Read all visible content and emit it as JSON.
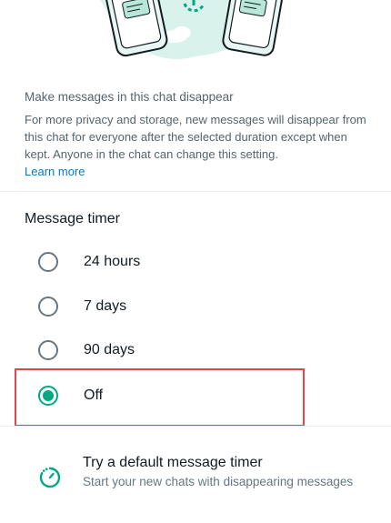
{
  "colors": {
    "accent": "#00a884",
    "link": "#027eb5",
    "highlight": "#e0454b"
  },
  "info": {
    "title": "Make messages in this chat disappear",
    "body": "For more privacy and storage, new messages will disappear from this chat for everyone after the selected duration except when kept. Anyone in the chat can change this setting.",
    "learn_more": "Learn more"
  },
  "timer": {
    "section_title": "Message timer",
    "options": [
      {
        "label": "24 hours",
        "selected": false
      },
      {
        "label": "7 days",
        "selected": false
      },
      {
        "label": "90 days",
        "selected": false
      },
      {
        "label": "Off",
        "selected": true
      }
    ]
  },
  "default_timer": {
    "icon": "timer-icon",
    "title": "Try a default message timer",
    "subtitle": "Start your new chats with disappearing messages"
  }
}
